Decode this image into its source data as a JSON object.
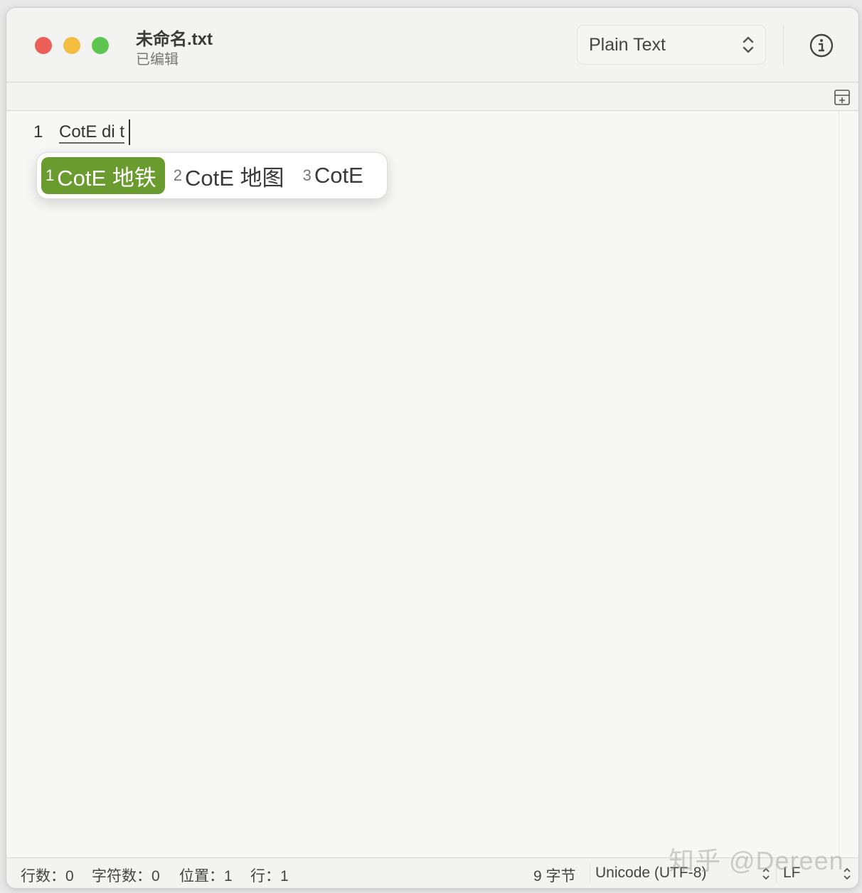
{
  "window": {
    "title": "未命名.txt",
    "subtitle": "已编辑"
  },
  "toolbar": {
    "syntax_mode": "Plain Text",
    "info_icon": "info-icon",
    "add_pane_icon": "add-pane-icon"
  },
  "editor": {
    "line_number": "1",
    "composing_text": "CotE di t"
  },
  "ime": {
    "candidates": [
      {
        "num": "1",
        "text": "CotE 地铁"
      },
      {
        "num": "2",
        "text": "CotE 地图"
      },
      {
        "num": "3",
        "text": "CotE"
      }
    ],
    "selected_color": "#6a9b2e"
  },
  "status": {
    "lines": "行数：0",
    "chars": "字符数：0",
    "position": "位置：1",
    "line": "行：1",
    "bytes": "9 字节",
    "encoding": "Unicode (UTF-8)",
    "line_ending": "LF"
  },
  "watermark": "知乎 @Dereen"
}
